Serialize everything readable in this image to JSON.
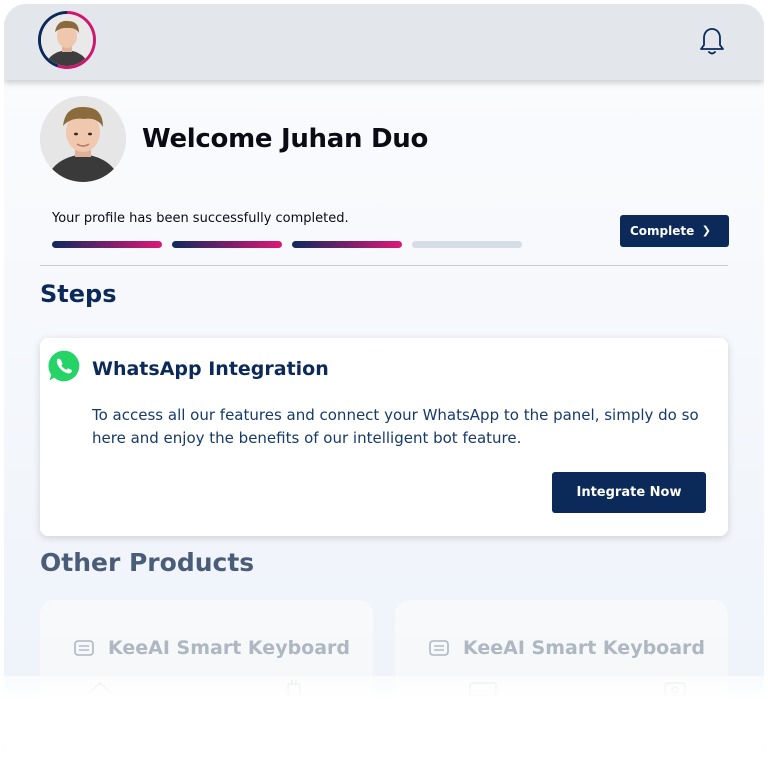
{
  "header": {
    "avatar_icon": "user-avatar",
    "bell_icon": "bell-icon"
  },
  "profile": {
    "welcome": "Welcome Juhan Duo",
    "status_message": "Your profile has been successfully completed.",
    "progress": {
      "completed_steps": 3,
      "total_steps": 4
    },
    "complete_button": "Complete",
    "colors": {
      "primary": "#0b2a5a",
      "accent": "#d0156e"
    }
  },
  "steps": {
    "title": "Steps",
    "card": {
      "icon": "whatsapp-icon",
      "title": "WhatsApp Integration",
      "description": "To access all our features and connect your WhatsApp to the panel, simply do so here and enjoy the benefits of our intelligent bot feature.",
      "button": "Integrate Now"
    }
  },
  "other_products": {
    "title": "Other Products",
    "items": [
      {
        "icon": "keyboard-icon",
        "title": "KeeAI Smart Keyboard"
      },
      {
        "icon": "keyboard-icon",
        "title": "KeeAI Smart Keyboard"
      }
    ]
  }
}
